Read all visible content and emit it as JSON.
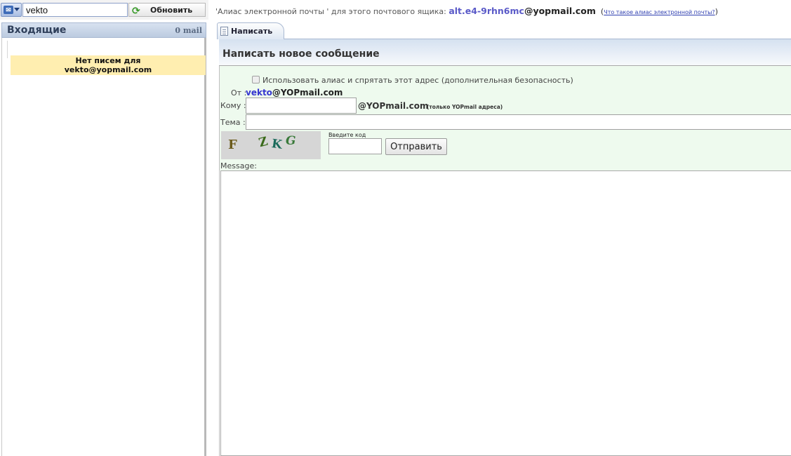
{
  "topbar": {
    "login_value": "vekto",
    "refresh_label": "Обновить"
  },
  "inbox": {
    "title": "Входящие",
    "count": "0 mail",
    "empty_line1": "Нет писем для",
    "empty_line2": "vekto@yopmail.com"
  },
  "alias": {
    "prefix": "'Алиас электронной почты ' для этого почтового ящика: ",
    "address_pre": "alt.e4-9rhn6mc",
    "address_domain": "@yopmail.com",
    "paren_open": "(",
    "help_link": "Что такое алиас электронной почты?",
    "paren_close": ")"
  },
  "tabs": {
    "compose": "Написать"
  },
  "compose": {
    "title": "Написать новое сообщение",
    "alias_checkbox_label": "Использовать алиас и спрятать этот адрес (дополнительная безопасность)",
    "from_label": "От :",
    "from_user": "vekto",
    "from_domain": "@YOPmail.com",
    "to_label": "Кому :",
    "to_domain": "@YOPmail.com",
    "to_note": "(только YOPmail адреса)",
    "subject_label": "Тема :",
    "captcha_hint": "Введите код",
    "captcha_chars": [
      "F",
      "Z",
      "K",
      "G"
    ],
    "send_label": "Отправить",
    "message_label": "Message:"
  },
  "colors": {
    "accent": "#3535d0",
    "notice_bg": "#ffeeb0",
    "form_bg": "#eefaee"
  },
  "icons": {
    "logo": "yopmail-logo-icon",
    "refresh": "refresh-arrows-icon",
    "compose_tab": "document-icon"
  }
}
